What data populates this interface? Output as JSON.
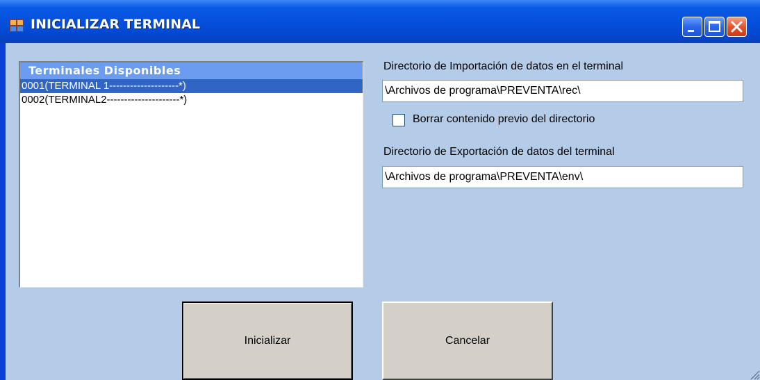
{
  "window": {
    "title": "INICIALIZAR TERMINAL"
  },
  "terminals": {
    "header": "Terminales Disponibles",
    "items": [
      {
        "label": "0001(TERMINAL 1--------------------*)",
        "selected": true
      },
      {
        "label": "0002(TERMINAL2---------------------*)",
        "selected": false
      }
    ]
  },
  "import": {
    "label": "Directorio de Importación de datos en el terminal",
    "value": "\\Archivos de programa\\PREVENTA\\rec\\"
  },
  "clear_checkbox": {
    "label": "Borrar contenido previo del directorio",
    "checked": false
  },
  "export": {
    "label": "Directorio de Exportación de datos del terminal",
    "value": "\\Archivos de programa\\PREVENTA\\env\\"
  },
  "buttons": {
    "initialize": "Inicializar",
    "cancel": "Cancelar"
  },
  "colors": {
    "titlebar": "#0550dc",
    "client": "#b5cce8",
    "list_header": "#6b9cf0",
    "selection": "#3165c4"
  },
  "icons": {
    "app": "app-window-icon",
    "minimize": "minimize-icon",
    "maximize": "maximize-icon",
    "close": "close-icon",
    "resize": "resize-grip-icon"
  }
}
